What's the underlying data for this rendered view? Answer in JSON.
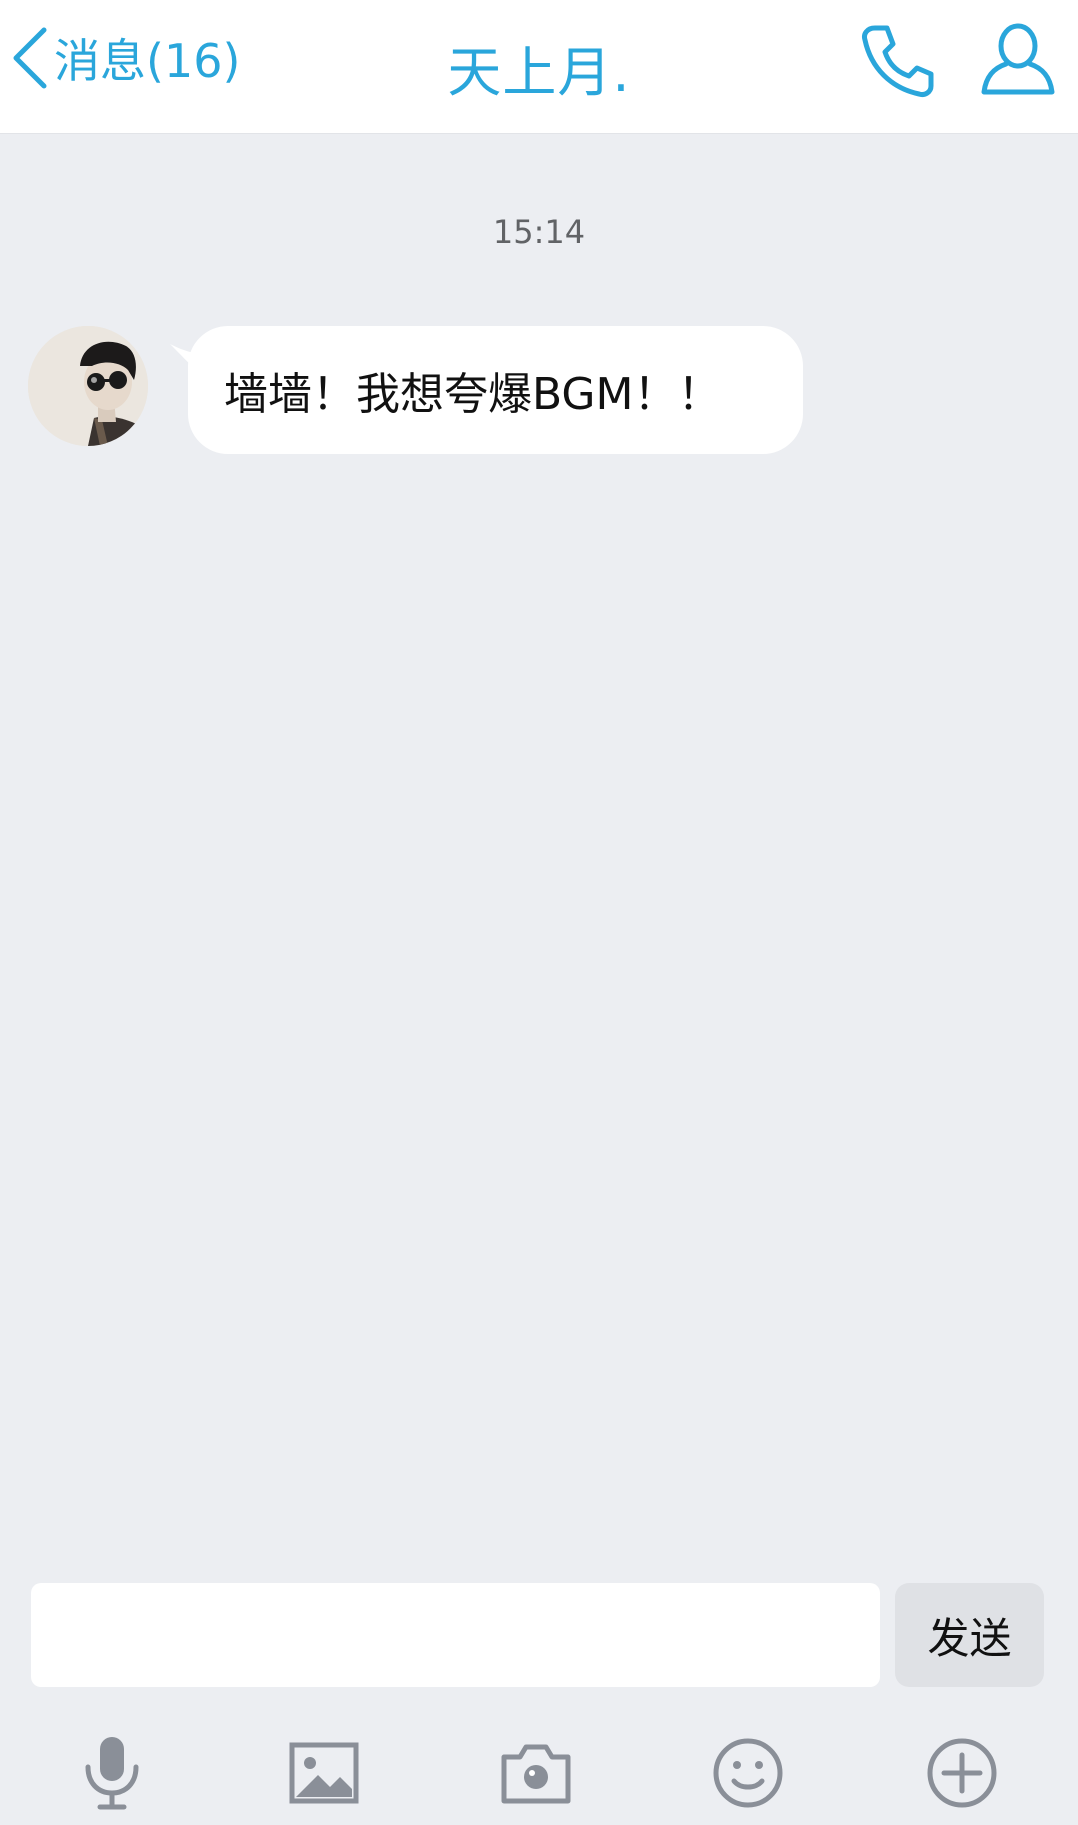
{
  "header": {
    "back_label": "消息(16)",
    "title": "天上月.",
    "accent_color": "#2aa6db",
    "icons": [
      "chevron-left-icon",
      "phone-icon",
      "profile-icon"
    ]
  },
  "chat": {
    "timestamp": "15:14",
    "messages": [
      {
        "sender": "received",
        "text": "墙墙！我想夸爆BGM！！"
      }
    ]
  },
  "input": {
    "value": "",
    "placeholder": "",
    "send_label": "发送"
  },
  "toolbar": {
    "icons": [
      "microphone-icon",
      "image-icon",
      "camera-icon",
      "emoji-icon",
      "add-icon"
    ],
    "icon_color": "#8a8f98"
  }
}
